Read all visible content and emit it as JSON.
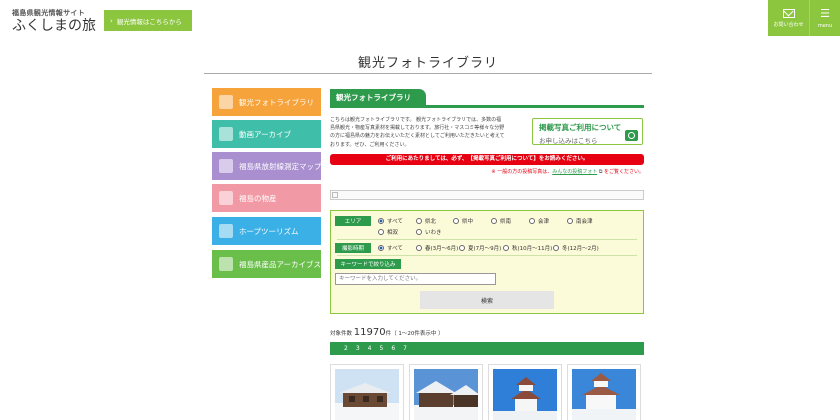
{
  "header": {
    "logo_top": "福島県観光情報サイト",
    "logo_main": "ふくしまの旅",
    "tourism_button": "観光情報はこちらから",
    "contact_label": "お問い合わせ",
    "menu_label": "menu"
  },
  "page_title": "観光フォトライブラリ",
  "sidebar": {
    "items": [
      {
        "label": "観光フォトライブラリ",
        "color": "#f5a33a"
      },
      {
        "label": "動画アーカイブ",
        "color": "#3fbfa9"
      },
      {
        "label": "福島県放射線測定マップ",
        "color": "#a98fd0"
      },
      {
        "label": "福島の物産",
        "color": "#f19aa5"
      },
      {
        "label": "ホープツーリズム",
        "color": "#3ab0e6"
      },
      {
        "label": "福島県産品アーカイブス",
        "color": "#6abf4b"
      }
    ]
  },
  "main": {
    "section_tab": "観光フォトライブラリ",
    "intro_lines": [
      "こちらは観光フォトライブラリです。 観光フォトライブラリでは、多数の福",
      "島県観光・物産写真素材を掲載しております。旅行社・マスコミ等様々な分野",
      "の方に福島県の魅力をお伝えいただく素材としてご利用いただきたいと考えて",
      "おります。ぜひ、ご利用ください。"
    ],
    "apply_banner": {
      "title": "掲載写真ご利用について",
      "subtitle": "お申し込みはこちら"
    },
    "notice": "ご利用にあたりましては、必ず、【掲載写真ご利用について】をお読みください。",
    "general_note": {
      "prefix": "※ 一般の方の投稿写真は、",
      "link": "みんなの投稿フォト",
      "suffix": "をご覧ください。"
    }
  },
  "search": {
    "area_label": "エリア",
    "area_options": [
      "すべて",
      "県北",
      "県中",
      "県南",
      "会津",
      "南会津",
      "相双",
      "いわき"
    ],
    "season_label": "撮影時期",
    "season_options": [
      "すべて",
      "春(3月～6月)",
      "夏(7月～9月)",
      "秋(10月～11月)",
      "冬(12月～2月)"
    ],
    "keyword_label": "キーワードで絞り込み",
    "keyword_placeholder": "キーワードを入力してください。",
    "button": "検索"
  },
  "results": {
    "count_prefix": "対象件数",
    "count": "11970",
    "count_suffix": "件（ 1～20件表示中 ）",
    "pages": [
      "2",
      "3",
      "4",
      "5",
      "6",
      "7"
    ]
  },
  "colors": {
    "accent_green": "#2e9a4c",
    "header_green": "#8cc63f",
    "notice_red": "#e60012",
    "search_bg": "#fcfbd9"
  }
}
